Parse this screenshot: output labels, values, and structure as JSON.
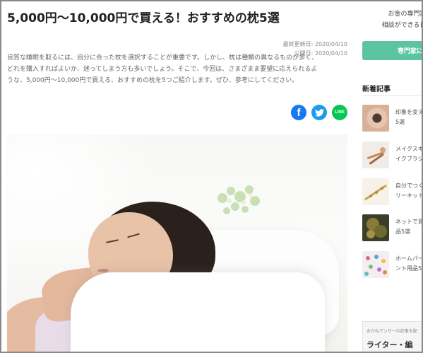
{
  "article": {
    "title": "5,000円〜10,000円で買える！おすすめの枕5選",
    "updated": "最終更新日: 2020/04/10",
    "published": "公開日: 2020/04/10",
    "intro": [
      "良質な睡眠を取るには、自分に合った枕を選択することが重要です。しかし、枕は種類の異なるものが多く、",
      "どれを購入すればよいか、迷ってしまう方も多いでしょう。そこで、今回は、さまざまま要望に応えられるよ",
      "うな、5,000円〜10,000円で買える、おすすめの枕を5つご紹介します。ぜひ、参考にしてください。"
    ],
    "share": [
      {
        "icon": "facebook-icon",
        "glyph": "f",
        "color": "#1877f2"
      },
      {
        "icon": "twitter-icon",
        "color": "#1d9bf0"
      },
      {
        "icon": "line-icon",
        "glyph": "LINE",
        "color": "#06c755"
      }
    ]
  },
  "sidebar": {
    "promo_line1": "お金の専門家に",
    "promo_line2": "相談ができる日本最",
    "cta_label": "専門家に",
    "cta_color": "#5cc49e",
    "new_heading": "新着記事",
    "items": [
      {
        "line1": "印象を変え",
        "line2": "5選",
        "thumb": "eye-makeup-thumbnail"
      },
      {
        "line1": "メイクスキ",
        "line2": "イクブラシ",
        "thumb": "makeup-brush-thumbnail"
      },
      {
        "line1": "自分でつく",
        "line2": "リーキット",
        "thumb": "accessory-kit-thumbnail"
      },
      {
        "line1": "ネットで買",
        "line2": "品5選",
        "thumb": "tea-thumbnail"
      },
      {
        "line1": "ホームパー",
        "line2": "ント用品5",
        "thumb": "party-goods-thumbnail"
      }
    ],
    "footer_small": "おかねアンサーの記事を配",
    "footer_big": "ライター・編"
  }
}
